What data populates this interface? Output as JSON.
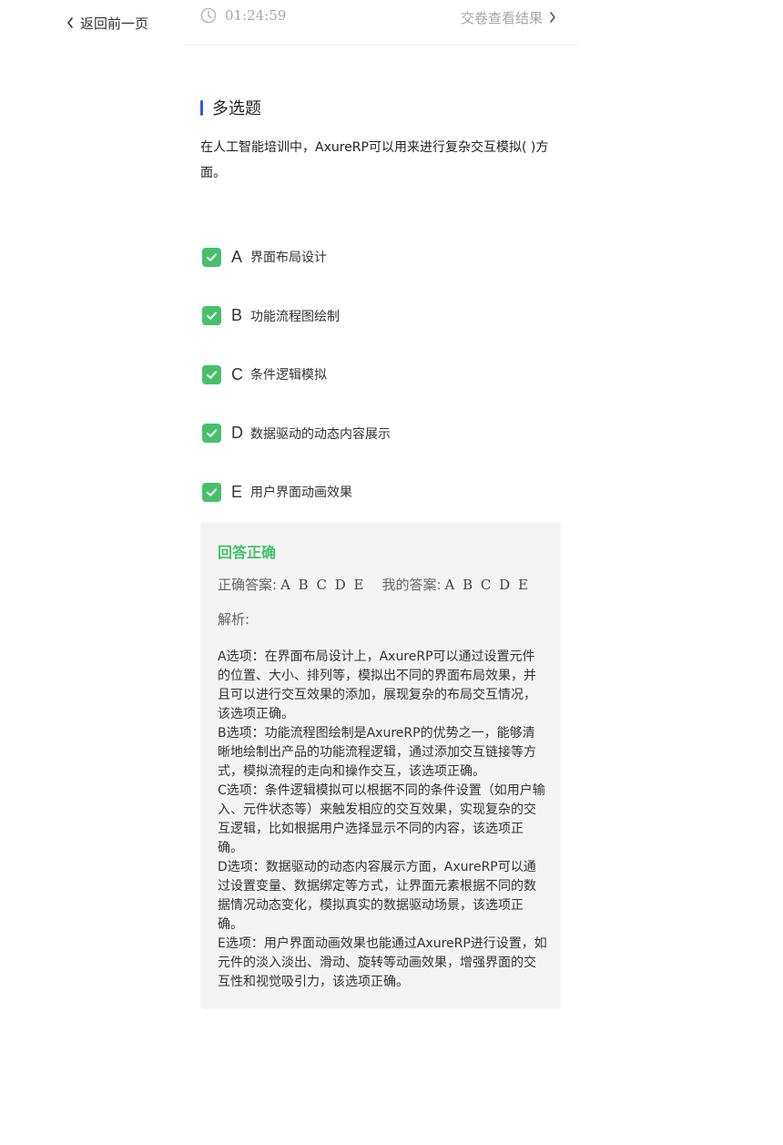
{
  "nav": {
    "back_label": "返回前一页"
  },
  "topbar": {
    "timer": "01:24:59",
    "submit_label": "交卷查看结果"
  },
  "question": {
    "type": "多选题",
    "text": "在人工智能培训中，AxureRP可以用来进行复杂交互模拟( )方面。",
    "options": [
      {
        "letter": "A",
        "text": "界面布局设计",
        "checked": true
      },
      {
        "letter": "B",
        "text": "功能流程图绘制",
        "checked": true
      },
      {
        "letter": "C",
        "text": "条件逻辑模拟",
        "checked": true
      },
      {
        "letter": "D",
        "text": "数据驱动的动态内容展示",
        "checked": true
      },
      {
        "letter": "E",
        "text": "用户界面动画效果",
        "checked": true
      }
    ]
  },
  "result": {
    "status": "回答正确",
    "correct_label": "正确答案:",
    "correct_value": "A B C D E",
    "mine_label": "我的答案:",
    "mine_value": "A B C D E",
    "analysis_label": "解析:",
    "analysis": [
      "A选项：在界面布局设计上，AxureRP可以通过设置元件的位置、大小、排列等，模拟出不同的界面布局效果，并且可以进行交互效果的添加，展现复杂的布局交互情况，该选项正确。",
      "B选项：功能流程图绘制是AxureRP的优势之一，能够清晰地绘制出产品的功能流程逻辑，通过添加交互链接等方式，模拟流程的走向和操作交互，该选项正确。",
      "C选项：条件逻辑模拟可以根据不同的条件设置（如用户输入、元件状态等）来触发相应的交互效果，实现复杂的交互逻辑，比如根据用户选择显示不同的内容，该选项正确。",
      "D选项：数据驱动的动态内容展示方面，AxureRP可以通过设置变量、数据绑定等方式，让界面元素根据不同的数据情况动态变化，模拟真实的数据驱动场景，该选项正确。",
      "E选项：用户界面动画效果也能通过AxureRP进行设置，如元件的淡入淡出、滑动、旋转等动画效果，增强界面的交互性和视觉吸引力，该选项正确。"
    ]
  },
  "colors": {
    "accent_blue": "#2f5be8",
    "success_green": "#47c06a",
    "muted_gray": "#a6a6a6",
    "panel_bg": "#f4f4f4"
  },
  "icons": {
    "back": "chevron-left-icon",
    "timer": "clock-icon",
    "submit": "chevron-right-icon",
    "checkbox": "checkmark-icon"
  }
}
